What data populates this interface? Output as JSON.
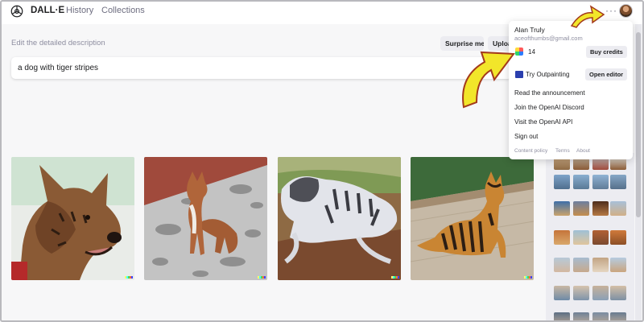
{
  "header": {
    "brand": "DALL·E",
    "nav": [
      {
        "label": "History"
      },
      {
        "label": "Collections"
      }
    ],
    "more_icon": "ellipsis-icon"
  },
  "prompt": {
    "label": "Edit the detailed description",
    "value": "a dog with tiger stripes",
    "surprise_label": "Surprise me",
    "upload_label": "Uploa"
  },
  "images": [
    {
      "alt_icon": "dog-image-1"
    },
    {
      "alt_icon": "dog-image-2"
    },
    {
      "alt_icon": "dog-image-3"
    },
    {
      "alt_icon": "dog-image-4"
    }
  ],
  "menu": {
    "name": "Alan Truly",
    "email": "aceofthumbs@gmail.com",
    "credits": "14",
    "buy_label": "Buy credits",
    "outpaint_label": "Try Outpainting",
    "editor_label": "Open editor",
    "links": [
      {
        "label": "Read the announcement"
      },
      {
        "label": "Join the OpenAI Discord"
      },
      {
        "label": "Visit the OpenAI API"
      },
      {
        "label": "Sign out"
      }
    ],
    "footer": [
      {
        "label": "Content policy"
      },
      {
        "label": "Terms"
      },
      {
        "label": "About"
      }
    ]
  },
  "colors": {
    "arrow_fill": "#f2e62a",
    "arrow_stroke": "#a33a1c"
  }
}
